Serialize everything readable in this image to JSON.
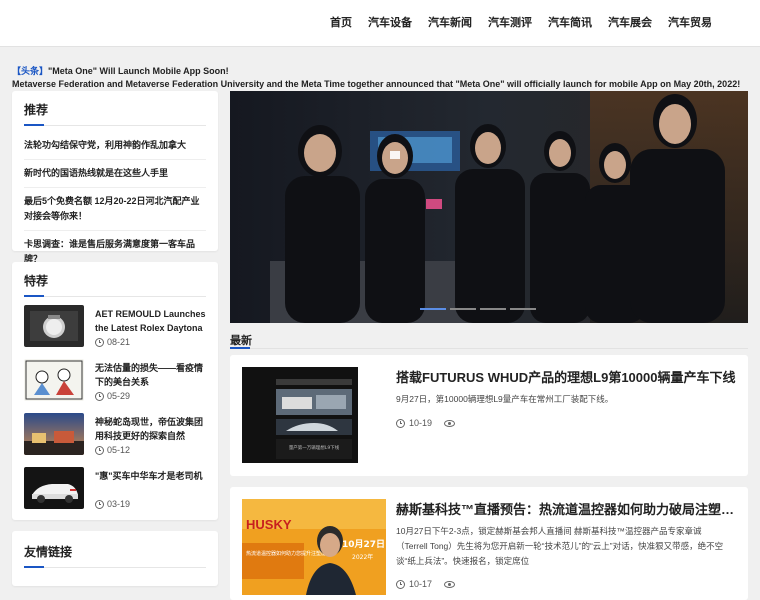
{
  "nav": [
    "首页",
    "汽车设备",
    "汽车新闻",
    "汽车测评",
    "汽车简讯",
    "汽车展会",
    "汽车贸易"
  ],
  "headline": {
    "tag": "【头条】",
    "text": "\"Meta One\" Will Launch Mobile App Soon!",
    "summary": "Metaverse Federation and Metaverse Federation University and the Meta Time together announced that \"Meta One\" will officially launch for mobile App on May 20th, 2022!"
  },
  "recommend": {
    "title": "推荐",
    "items": [
      "法轮功勾结保守党，利用神韵作乱加拿大",
      "新时代的国语热线就是在这些人手里",
      "最后5个免费名额 12月20-22日河北汽配产业对接会等你来！",
      "卡思调查：谁是售后服务满意度第一客车品牌？"
    ]
  },
  "featured": {
    "title": "特荐",
    "items": [
      {
        "title": "AET REMOULD Launches the Latest Rolex Daytona",
        "date": "08-21"
      },
      {
        "title": "无法估量的损失——看疫情下的美台关系",
        "date": "05-29"
      },
      {
        "title": "神秘蛇岛现世，帝伍波集团用科技更好的探索自然",
        "date": "05-12"
      },
      {
        "title": "\"惠\"买车中华车才是老司机",
        "date": "03-19"
      }
    ]
  },
  "links": {
    "title": "友情链接"
  },
  "latest": {
    "title": "最新",
    "articles": [
      {
        "title": "搭载FUTURUS WHUD产品的理想L9第10000辆量产车下线",
        "desc": "9月27日，第10000辆理想L9量产车在常州工厂装配下线。",
        "date": "10-19",
        "thumb_caption": "量产第一万辆理想L9下线"
      },
      {
        "title": "赫斯基科技™直播预告：热流道温控器如何助力破局注塑行业痛点？",
        "desc": "10月27日下午2-3点，锁定赫斯基会邦人直播间 赫斯基科技™温控器产品专家章诚（Terrell Tong）先生将为您开启新一轮“技术范儿”的“云上”对话，快准狠又带感，绝不空谈“纸上兵法”。快速报名，锁定席位",
        "date": "10-17",
        "thumb_brand": "HUSKY",
        "thumb_date": "10月27日",
        "thumb_year": "2022年",
        "thumb_text": "热流道温控器如何助力您提升注塑能力？"
      }
    ]
  }
}
